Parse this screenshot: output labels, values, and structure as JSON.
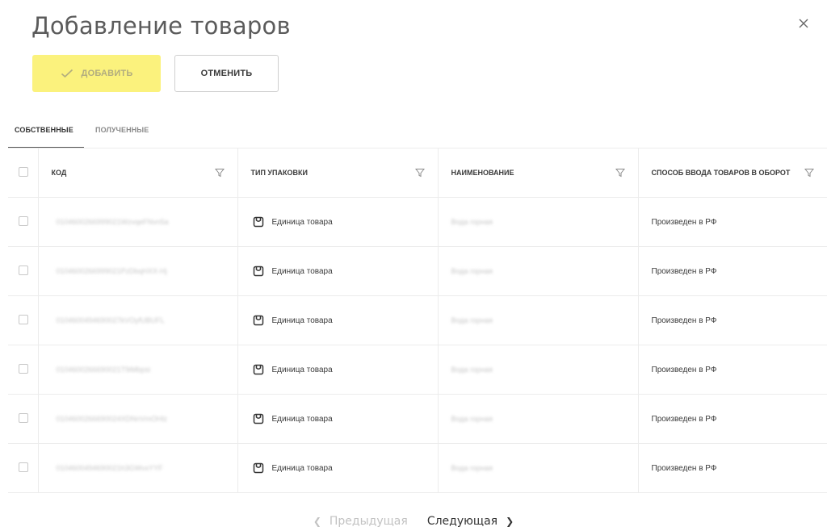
{
  "header": {
    "title": "Добавление товаров",
    "close_icon": "close-icon"
  },
  "toolbar": {
    "add_label": "ДОБАВИТЬ",
    "cancel_label": "ОТМЕНИТЬ",
    "add_color": "#fbf27d"
  },
  "tabs": [
    {
      "label": "СОБСТВЕННЫЕ",
      "active": true
    },
    {
      "label": "ПОЛУЧЕННЫЕ",
      "active": false
    }
  ],
  "table": {
    "columns": [
      {
        "label": "КОД"
      },
      {
        "label": "ТИП УПАКОВКИ"
      },
      {
        "label": "НАИМЕНОВАНИЕ"
      },
      {
        "label": "СПОСОБ ВВОДА ТОВАРОВ В ОБОРОТ"
      }
    ],
    "rows": [
      {
        "code": "0104600266999021WzvqeFNvn5a",
        "package": "Единица товара",
        "name": "Вода горная",
        "method": "Произведен в РФ"
      },
      {
        "code": "0104600266999021PzDbqHXX-Hj",
        "package": "Единица товара",
        "name": "Вода горная",
        "method": "Произведен в РФ"
      },
      {
        "code": "0104600494690027kVOyfUBUFL",
        "package": "Единица товара",
        "name": "Вода горная",
        "method": "Произведен в РФ"
      },
      {
        "code": "0104600266690021T9iMbpsi",
        "package": "Единица товара",
        "name": "Вода горная",
        "method": "Произведен в РФ"
      },
      {
        "code": "0104600266690024XDNnVmOHlz",
        "package": "Единица товара",
        "name": "Вода горная",
        "method": "Произведен в РФ"
      },
      {
        "code": "0104600494690021h3GWvxYYF",
        "package": "Единица товара",
        "name": "Вода горная",
        "method": "Произведен в РФ"
      }
    ]
  },
  "pagination": {
    "prev_label": "Предыдущая",
    "next_label": "Следующая"
  }
}
